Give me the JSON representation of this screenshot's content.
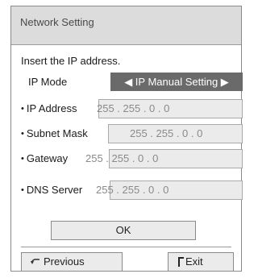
{
  "dialog": {
    "title": "Network Setting",
    "instruction": "Insert the IP address."
  },
  "ip_mode": {
    "label": "IP Mode",
    "value": "◀ IP Manual Setting ▶"
  },
  "fields": {
    "ip_address": {
      "label": "IP Address",
      "value": "255 . 255 . 0 . 0"
    },
    "subnet_mask": {
      "label": "Subnet Mask",
      "value": "255 . 255 . 0 . 0"
    },
    "gateway": {
      "label": "Gateway",
      "value": "255 . 255 . 0 . 0"
    },
    "dns_server": {
      "label": "DNS Server",
      "value": "255 . 255 . 0 . 0"
    }
  },
  "buttons": {
    "ok": "OK",
    "previous": "Previous",
    "exit": "Exit"
  },
  "icons": {
    "bullet": "•",
    "previous": "return-arrow-icon",
    "exit": "exit-corner-icon"
  }
}
